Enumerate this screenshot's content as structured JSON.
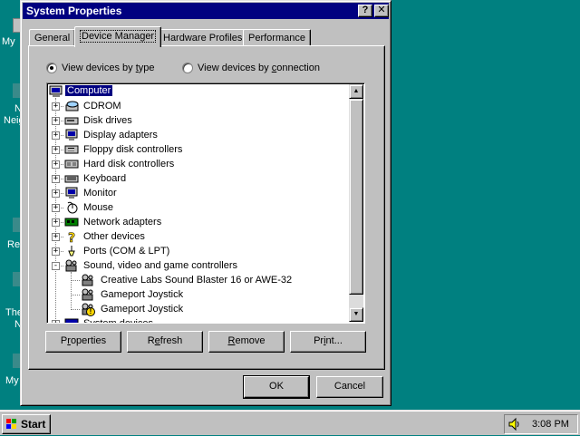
{
  "desktop": {
    "icon_labels": [
      "My",
      "N",
      "Neig",
      "Re",
      "The",
      "N",
      "My"
    ]
  },
  "window": {
    "title": "System Properties",
    "help_button": "?",
    "close_button": "✕"
  },
  "tabs": [
    {
      "label": "General",
      "active": false
    },
    {
      "label": "Device Manager",
      "active": true
    },
    {
      "label": "Hardware Profiles",
      "active": false
    },
    {
      "label": "Performance",
      "active": false
    }
  ],
  "view_options": {
    "by_type": {
      "label_pre": "View devices by ",
      "label_ul": "t",
      "label_post": "ype",
      "selected": true
    },
    "by_connection": {
      "label_pre": "View devices by ",
      "label_ul": "c",
      "label_post": "onnection",
      "selected": false
    }
  },
  "tree": {
    "root": {
      "label": "Computer",
      "icon": "computer-icon",
      "selected": true
    },
    "categories": [
      {
        "label": "CDROM",
        "icon": "cdrom-icon",
        "expanded": false
      },
      {
        "label": "Disk drives",
        "icon": "disk-drive-icon",
        "expanded": false
      },
      {
        "label": "Display adapters",
        "icon": "monitor-icon",
        "expanded": false
      },
      {
        "label": "Floppy disk controllers",
        "icon": "floppy-controller-icon",
        "expanded": false
      },
      {
        "label": "Hard disk controllers",
        "icon": "hard-disk-controller-icon",
        "expanded": false
      },
      {
        "label": "Keyboard",
        "icon": "keyboard-icon",
        "expanded": false
      },
      {
        "label": "Monitor",
        "icon": "monitor-icon",
        "expanded": false
      },
      {
        "label": "Mouse",
        "icon": "mouse-icon",
        "expanded": false
      },
      {
        "label": "Network adapters",
        "icon": "network-adapter-icon",
        "expanded": false
      },
      {
        "label": "Other devices",
        "icon": "question-mark-icon",
        "expanded": false
      },
      {
        "label": "Ports (COM & LPT)",
        "icon": "port-icon",
        "expanded": false
      },
      {
        "label": "Sound, video and game controllers",
        "icon": "multimedia-icon",
        "expanded": true
      },
      {
        "label": "System devices",
        "icon": "system-device-icon",
        "expanded": false
      }
    ],
    "sound_children": [
      {
        "label": "Creative Labs Sound Blaster 16 or AWE-32",
        "icon": "multimedia-icon",
        "warning": false
      },
      {
        "label": "Gameport Joystick",
        "icon": "multimedia-icon",
        "warning": false
      },
      {
        "label": "Gameport Joystick",
        "icon": "multimedia-icon",
        "warning": true
      }
    ]
  },
  "buttons": {
    "properties": {
      "pre": "P",
      "ul": "r",
      "post": "operties"
    },
    "refresh": {
      "pre": "R",
      "ul": "e",
      "post": "fresh"
    },
    "remove": {
      "pre": "",
      "ul": "R",
      "post": "emove"
    },
    "print": {
      "pre": "Pr",
      "ul": "i",
      "post": "nt..."
    },
    "ok": "OK",
    "cancel": "Cancel"
  },
  "taskbar": {
    "start_label": "Start",
    "clock": "3:08 PM"
  },
  "colors": {
    "desktop": "#008080",
    "title_bar": "#000080",
    "selection": "#000080",
    "face": "#c0c0c0"
  }
}
